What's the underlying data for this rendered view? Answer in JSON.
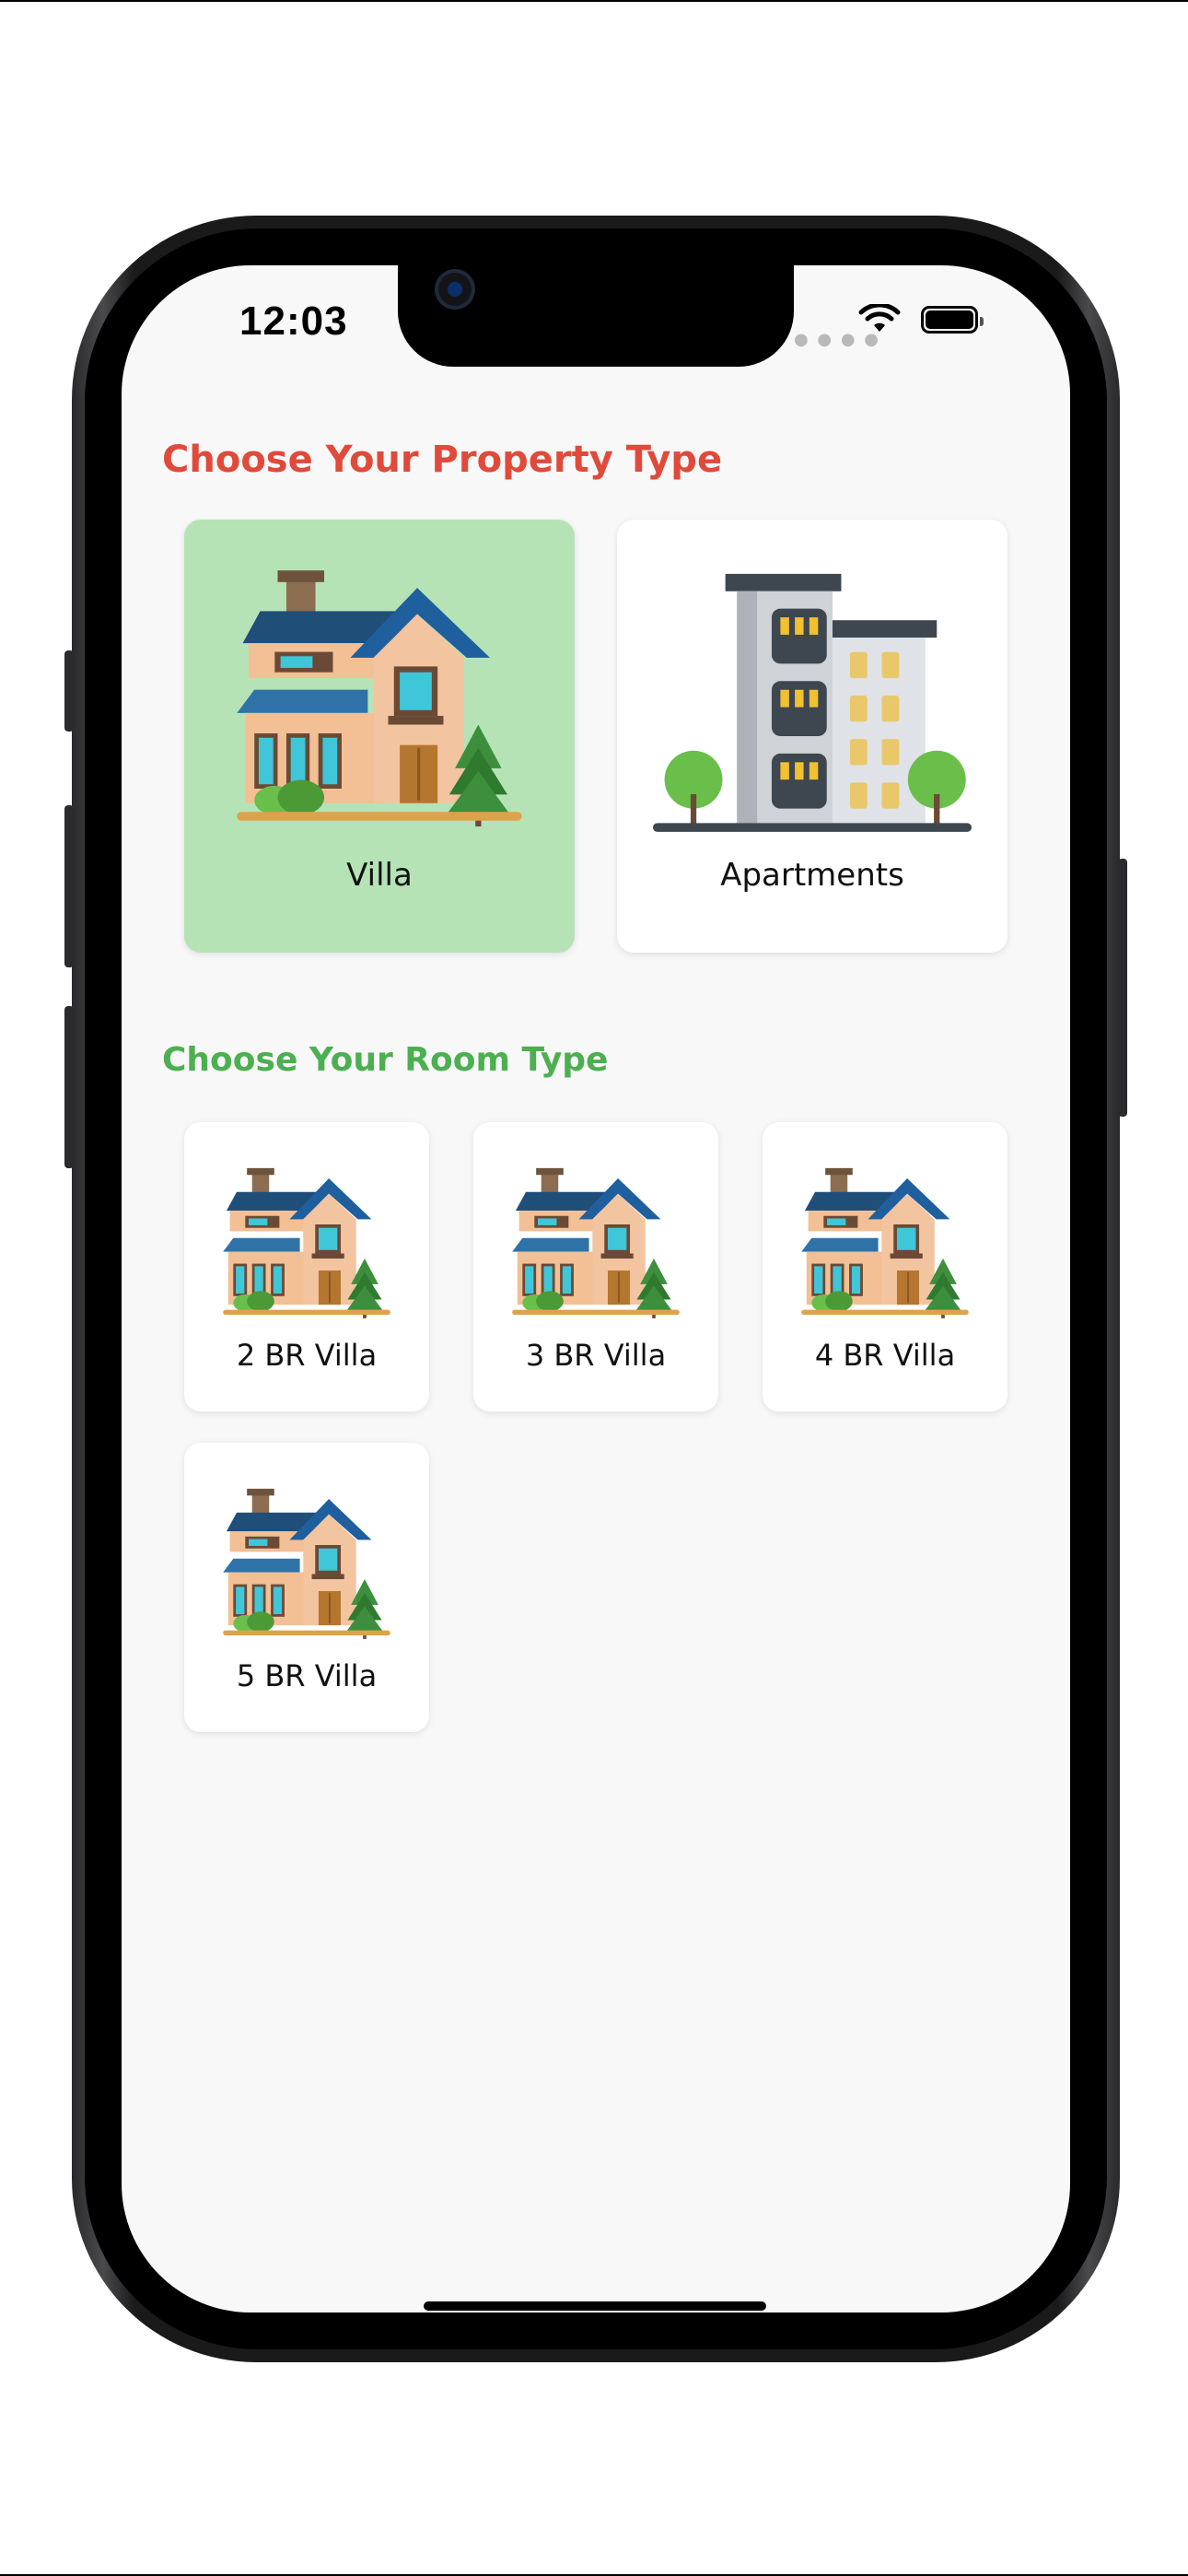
{
  "status_bar": {
    "time": "12:03",
    "signal_icon": "signal-dots-icon",
    "wifi_icon": "wifi-icon",
    "battery_icon": "battery-icon"
  },
  "property_section": {
    "title": "Choose Your Property Type",
    "title_color": "#e04a3b",
    "items": [
      {
        "label": "Villa",
        "icon": "villa-house-icon",
        "selected": true
      },
      {
        "label": "Apartments",
        "icon": "apartment-building-icon",
        "selected": false
      }
    ]
  },
  "room_section": {
    "title": "Choose Your Room Type",
    "title_color": "#4caf50",
    "items": [
      {
        "label": "2 BR Villa",
        "icon": "villa-house-icon"
      },
      {
        "label": "3 BR Villa",
        "icon": "villa-house-icon"
      },
      {
        "label": "4 BR Villa",
        "icon": "villa-house-icon"
      },
      {
        "label": "5 BR Villa",
        "icon": "villa-house-icon"
      }
    ]
  },
  "colors": {
    "selected_card": "#b5e3b6",
    "card": "#ffffff",
    "screen_background": "#f8f8f8"
  }
}
